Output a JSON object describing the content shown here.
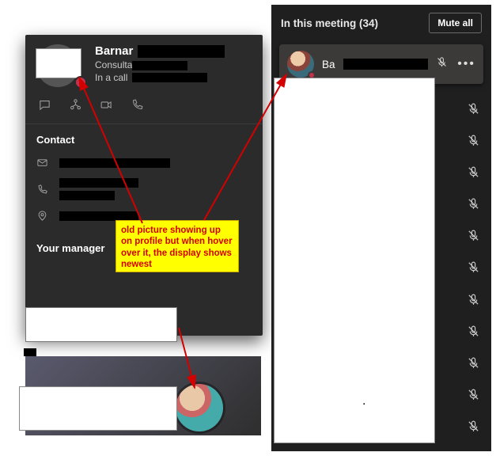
{
  "profile": {
    "name_visible": "Barnar",
    "role_visible": "Consulta",
    "status_visible": "In a call",
    "contact_section_title": "Contact",
    "manager_section_title": "Your manager"
  },
  "meeting": {
    "header_label": "In this meeting (34)",
    "mute_all_label": "Mute all",
    "first_participant_name_visible": "Ba",
    "muted_rows_count": 11
  },
  "annotation": {
    "text": "old picture showing up on profile but when hover over it, the display shows newest"
  },
  "icons": {
    "chat": "chat",
    "org": "org",
    "video": "video",
    "phone": "phone",
    "email": "email",
    "location": "location",
    "mic_muted": "mic-muted",
    "more": "more"
  }
}
